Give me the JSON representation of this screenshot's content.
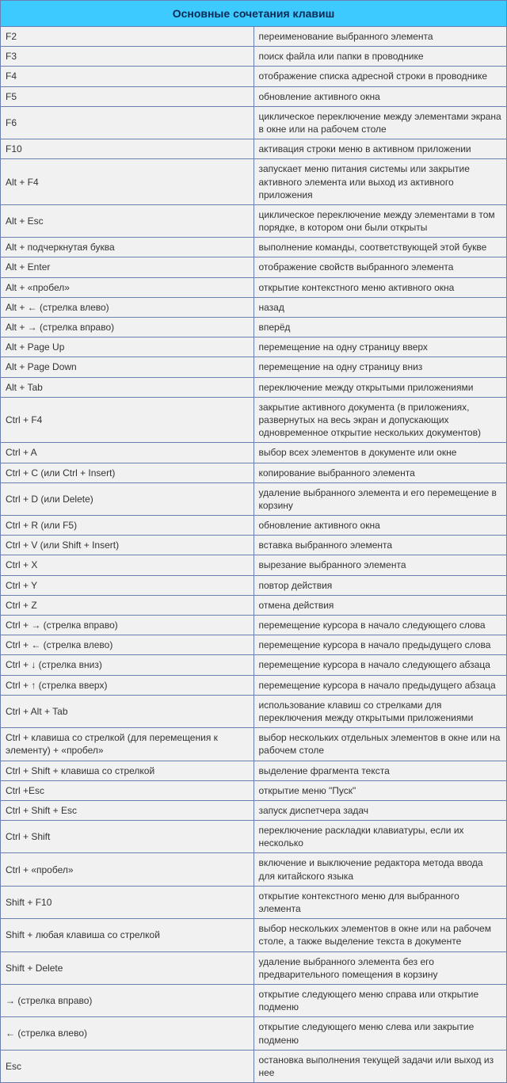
{
  "title": "Основные сочетания клавиш",
  "rows": [
    {
      "key": "F2",
      "desc": "переименование выбранного элемента"
    },
    {
      "key": "F3",
      "desc": "поиск файла или папки в проводнике"
    },
    {
      "key": "F4",
      "desc": "отображение списка адресной строки в проводнике"
    },
    {
      "key": "F5",
      "desc": "обновление активного окна"
    },
    {
      "key": "F6",
      "desc": "циклическое переключение между элементами экрана в окне или на рабочем столе"
    },
    {
      "key": "F10",
      "desc": "активация строки меню в активном приложении"
    },
    {
      "key": "Alt + F4",
      "desc": "запускает меню питания системы или закрытие активного элемента или выход из активного приложения"
    },
    {
      "key": "Alt + Esc",
      "desc": "циклическое переключение между элементами в том порядке, в котором они были открыты"
    },
    {
      "key": "Alt + подчеркнутая буква",
      "desc": "выполнение команды, соответствующей этой букве"
    },
    {
      "key": "Alt + Enter",
      "desc": "отображение свойств выбранного элемента"
    },
    {
      "key": "Alt + «пробел»",
      "desc": "открытие контекстного меню активного окна"
    },
    {
      "key": "Alt + ← (стрелка влево)",
      "desc": "назад"
    },
    {
      "key": "Alt + → (стрелка вправо)",
      "desc": "вперёд"
    },
    {
      "key": "Alt + Page Up",
      "desc": "перемещение на одну страницу вверх"
    },
    {
      "key": "Alt + Page Down",
      "desc": "перемещение на одну страницу вниз"
    },
    {
      "key": "Alt + Tab",
      "desc": "переключение между открытыми приложениями"
    },
    {
      "key": "Ctrl + F4",
      "desc": "закрытие активного документа (в приложениях, развернутых на весь экран и допускающих одновременное открытие нескольких документов)"
    },
    {
      "key": "Ctrl + A",
      "desc": "выбор всех элементов в документе или окне"
    },
    {
      "key": "Ctrl + C (или Ctrl + Insert)",
      "desc": "копирование выбранного элемента"
    },
    {
      "key": "Ctrl + D (или Delete)",
      "desc": "удаление выбранного элемента и его перемещение в корзину"
    },
    {
      "key": "Ctrl + R (или F5)",
      "desc": "обновление активного окна"
    },
    {
      "key": "Ctrl + V (или Shift + Insert)",
      "desc": "вставка выбранного элемента"
    },
    {
      "key": "Ctrl + X",
      "desc": "вырезание выбранного элемента"
    },
    {
      "key": "Ctrl + Y",
      "desc": "повтор действия"
    },
    {
      "key": "Ctrl + Z",
      "desc": "отмена действия"
    },
    {
      "key": "Ctrl + → (стрелка вправо)",
      "desc": "перемещение курсора в начало следующего слова"
    },
    {
      "key": "Ctrl + ← (стрелка влево)",
      "desc": "перемещение курсора в начало предыдущего слова"
    },
    {
      "key": "Ctrl + ↓ (стрелка вниз)",
      "desc": "перемещение курсора в начало следующего абзаца"
    },
    {
      "key": "Ctrl + ↑ (стрелка вверх)",
      "desc": "перемещение курсора в начало предыдущего абзаца"
    },
    {
      "key": "Ctrl + Alt + Tab",
      "desc": "использование клавиш со стрелками для переключения между открытыми приложениями"
    },
    {
      "key": "Ctrl + клавиша со стрелкой (для перемещения к элементу) + «пробел»",
      "desc": "выбор нескольких отдельных элементов в окне или на рабочем столе"
    },
    {
      "key": "Ctrl + Shift + клавиша со стрелкой",
      "desc": "выделение фрагмента текста"
    },
    {
      "key": "Ctrl +Esc",
      "desc": "открытие меню \"Пуск\""
    },
    {
      "key": "Ctrl + Shift + Esc",
      "desc": "запуск диспетчера задач"
    },
    {
      "key": "Ctrl + Shift",
      "desc": "переключение раскладки клавиатуры, если их несколько"
    },
    {
      "key": "Ctrl + «пробел»",
      "desc": "включение и выключение редактора метода ввода для китайского языка"
    },
    {
      "key": "Shift + F10",
      "desc": "открытие контекстного меню для выбранного элемента"
    },
    {
      "key": "Shift + любая клавиша со стрелкой",
      "desc": "выбор нескольких элементов в окне или на рабочем столе, а также выделение текста в документе"
    },
    {
      "key": "Shift + Delete",
      "desc": "удаление выбранного элемента без его предварительного помещения в корзину"
    },
    {
      "key": "→ (стрелка вправо)",
      "desc": "открытие следующего меню справа или открытие подменю"
    },
    {
      "key": "← (стрелка влево)",
      "desc": "открытие следующего меню слева или закрытие подменю"
    },
    {
      "key": "Esc",
      "desc": "остановка выполнения текущей задачи или выход из нее"
    }
  ]
}
